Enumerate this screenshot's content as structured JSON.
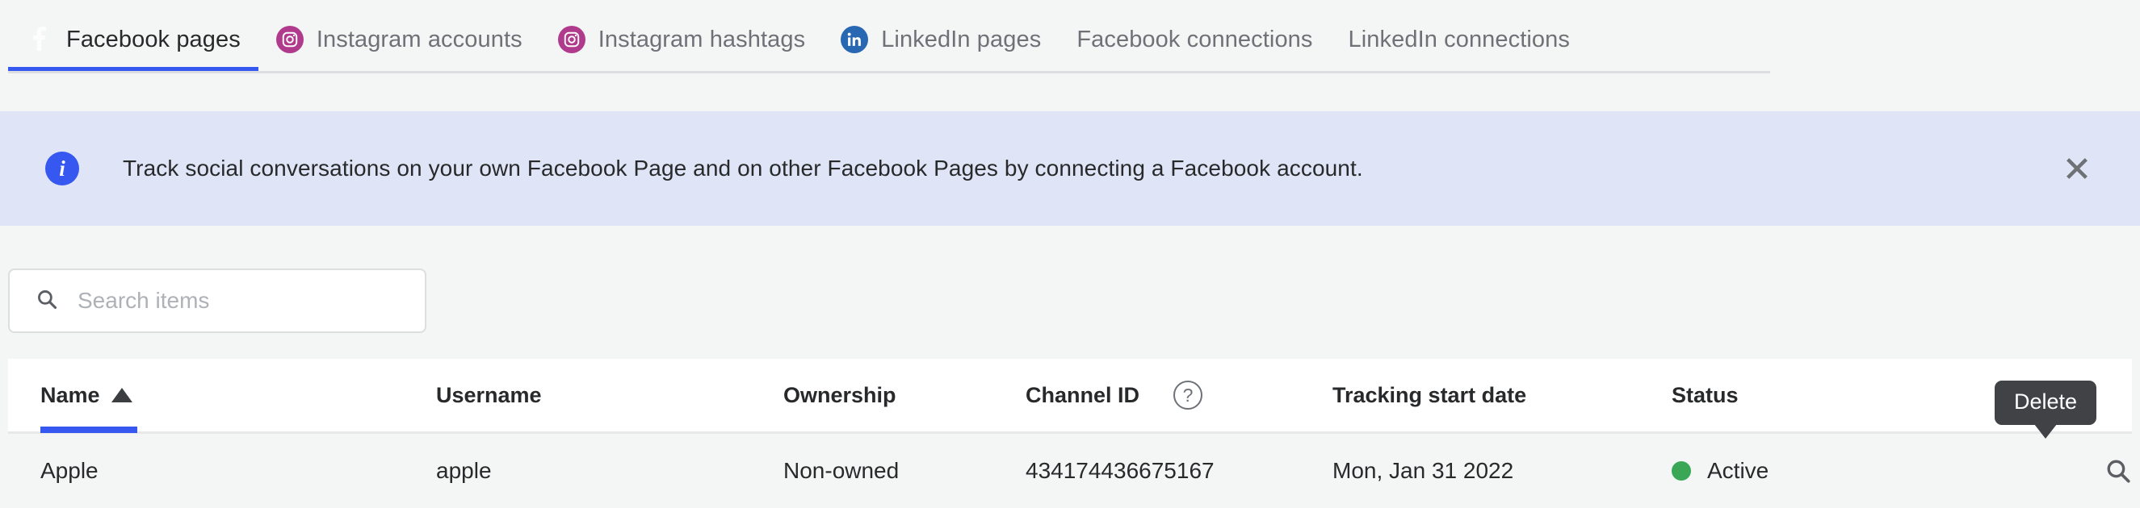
{
  "tabs": [
    {
      "label": "Facebook pages",
      "icon": "facebook-icon",
      "active": true
    },
    {
      "label": "Instagram accounts",
      "icon": "instagram-icon",
      "active": false
    },
    {
      "label": "Instagram hashtags",
      "icon": "instagram-icon",
      "active": false
    },
    {
      "label": "LinkedIn pages",
      "icon": "linkedin-icon",
      "active": false
    },
    {
      "label": "Facebook connections",
      "icon": "none",
      "active": false
    },
    {
      "label": "LinkedIn connections",
      "icon": "none",
      "active": false
    }
  ],
  "banner": {
    "icon": "info-icon",
    "icon_glyph": "i",
    "message": "Track social conversations on your own Facebook Page and on other Facebook Pages by connecting a Facebook account.",
    "close_label": "close-icon",
    "background_color": "#dfe5f6",
    "icon_color": "#3657f0"
  },
  "search": {
    "placeholder": "Search items",
    "value": "",
    "icon": "search-icon"
  },
  "table": {
    "columns": [
      {
        "label": "Name",
        "sorted": true,
        "sort_direction": "asc",
        "help": false
      },
      {
        "label": "Username",
        "sorted": false,
        "help": false
      },
      {
        "label": "Ownership",
        "sorted": false,
        "help": false
      },
      {
        "label": "Channel ID",
        "sorted": false,
        "help": true,
        "help_glyph": "?"
      },
      {
        "label": "Tracking start date",
        "sorted": false,
        "help": false
      },
      {
        "label": "Status",
        "sorted": false,
        "help": false
      }
    ],
    "rows": [
      {
        "name": "Apple",
        "username": "apple",
        "ownership": "Non-owned",
        "channel_id": "434174436675167",
        "tracking_start_date": "Mon, Jan 31 2022",
        "status": "Active",
        "status_color": "#3aa757",
        "actions": [
          "search-icon",
          "delete-icon"
        ]
      }
    ]
  },
  "tooltip": {
    "text": "Delete"
  },
  "colors": {
    "accent": "#3657f0",
    "instagram": "#b03a8c",
    "linkedin": "#2867b2",
    "status_active": "#3aa757",
    "delete": "#2c4bd8"
  }
}
